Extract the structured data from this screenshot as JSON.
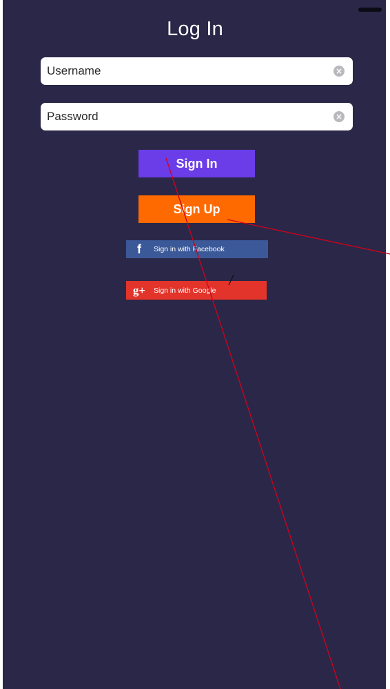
{
  "title": "Log In",
  "username": {
    "placeholder": "Username",
    "value": ""
  },
  "password": {
    "placeholder": "Password",
    "value": ""
  },
  "sign_in_label": "Sign In",
  "sign_up_label": "Sign Up",
  "facebook": {
    "icon": "f",
    "label": "Sign in with Facebook"
  },
  "google": {
    "icon": "g+",
    "label": "Sign in with Google"
  },
  "colors": {
    "background": "#2b2748",
    "sign_in": "#6a3de8",
    "sign_up": "#ff6a00",
    "facebook": "#3b5998",
    "google": "#e2342a",
    "annotation_line": "#d0021b"
  }
}
